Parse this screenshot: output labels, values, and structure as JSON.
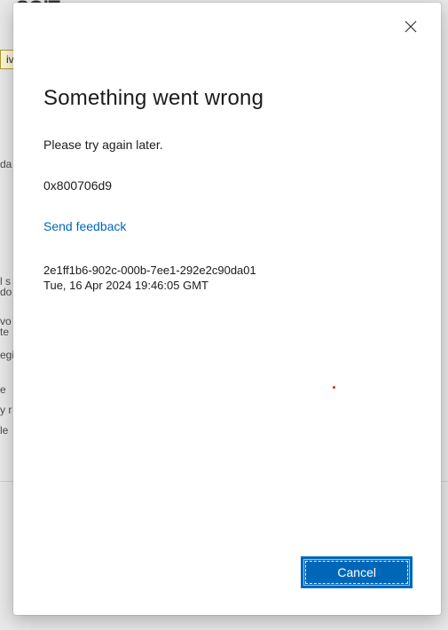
{
  "background": {
    "title_fragment": "SOIT",
    "button_fragment": "iv"
  },
  "dialog": {
    "title": "Something went wrong",
    "message": "Please try again later.",
    "error_code": "0x800706d9",
    "feedback_link": "Send feedback",
    "session_id": "2e1ff1b6-902c-000b-7ee1-292e2c90da01",
    "timestamp": "Tue, 16 Apr 2024 19:46:05 GMT",
    "cancel_label": "Cancel"
  }
}
